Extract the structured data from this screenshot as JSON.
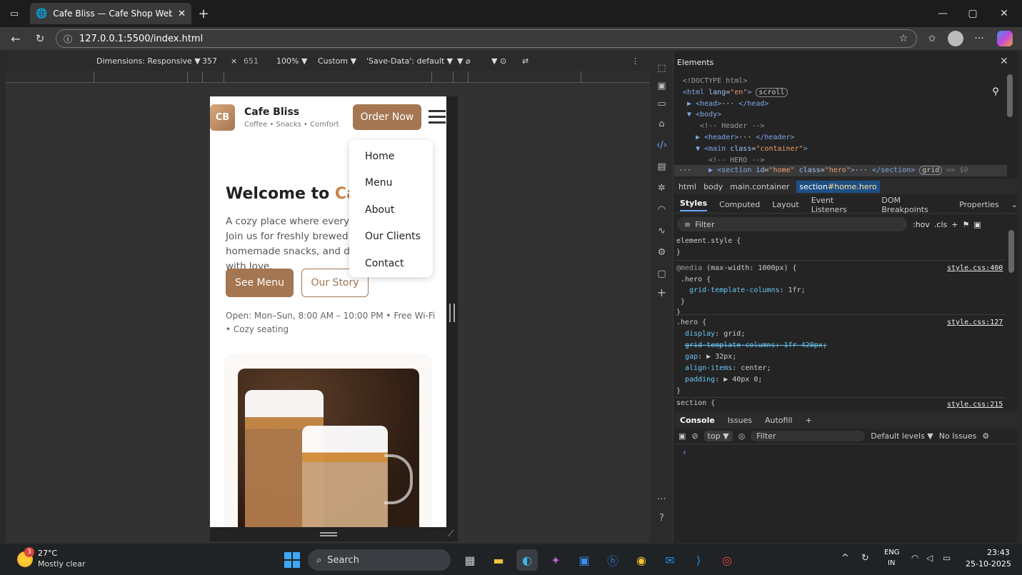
{
  "browser": {
    "tab_title": "Cafe Bliss — Cafe Shop Website",
    "url": "127.0.0.1:5500/index.html",
    "new_tab": "+",
    "window_controls": [
      "—",
      "▢",
      "✕"
    ]
  },
  "device_toolbar": {
    "dimensions": "Dimensions: Responsive ▼",
    "width": "357",
    "times": "×",
    "height": "651",
    "zoom": "100% ▼",
    "throttle": "Custom ▼",
    "save_data": "'Save-Data': default ▼",
    "more": "⋮"
  },
  "site": {
    "logo": "CB",
    "name": "Cafe Bliss",
    "tagline": "Coffee • Snacks • Comfort",
    "order_btn": "Order Now",
    "menu_items": [
      "Home",
      "Menu",
      "About",
      "Our Clients",
      "Contact"
    ],
    "hero_title_a": "Welcome to ",
    "hero_title_b": "Cafe Bliss",
    "hero_text": "A cozy place where every cup tells a story. Join us for freshly brewed coffee, homemade snacks, and desserts made with love.",
    "btn_menu": "See Menu",
    "btn_story": "Our Story",
    "hours": "Open: Mon–Sun, 8:00 AM – 10:00 PM • Free Wi-Fi • Cozy seating"
  },
  "devtools": {
    "panel_title": "Elements",
    "breadcrumbs": [
      "html",
      "body",
      "main.container"
    ],
    "breadcrumb_active_a": "section",
    "breadcrumb_active_b": "#home.hero",
    "tabs": [
      "Styles",
      "Computed",
      "Layout",
      "Event Listeners",
      "DOM Breakpoints",
      "Properties"
    ],
    "filter": "Filter",
    "hov": ":hov",
    "cls": ".cls",
    "src_400": "style.css:400",
    "src_127": "style.css:127",
    "src_215": "style.css:215",
    "console_tabs": [
      "Console",
      "Issues",
      "Autofill"
    ],
    "console_top": "top ▼",
    "console_filter": "Filter",
    "levels": "Default levels ▼",
    "issues": "No Issues"
  },
  "taskbar": {
    "temp": "27°C",
    "weather": "Mostly clear",
    "badge": "3",
    "search": "Search",
    "lang1": "ENG",
    "lang2": "IN",
    "time": "23:43",
    "date": "25-10-2025"
  },
  "colors": {
    "brand": "#a47651",
    "accent": "#c8824a"
  }
}
